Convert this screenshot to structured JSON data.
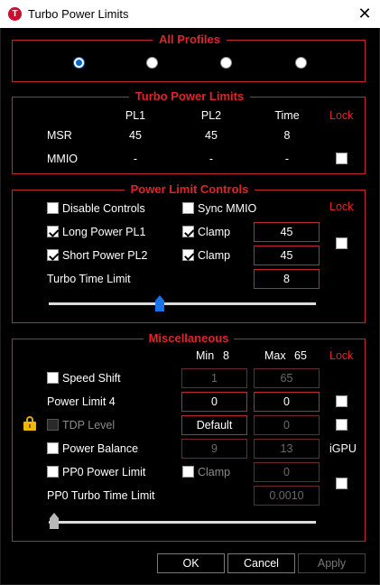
{
  "window": {
    "title": "Turbo Power Limits",
    "icon_letter": "T",
    "close_glyph": "✕"
  },
  "all_profiles": {
    "title": "All Profiles",
    "selected_index": 0,
    "count": 4
  },
  "turbo_power_limits": {
    "title": "Turbo Power Limits",
    "headers": {
      "pl1": "PL1",
      "pl2": "PL2",
      "time": "Time",
      "lock": "Lock"
    },
    "rows": [
      {
        "label": "MSR",
        "pl1": "45",
        "pl2": "45",
        "time": "8"
      },
      {
        "label": "MMIO",
        "pl1": "-",
        "pl2": "-",
        "time": "-"
      }
    ],
    "mmio_lock_checked": false
  },
  "power_limit_controls": {
    "title": "Power Limit Controls",
    "lock_label": "Lock",
    "disable_controls": {
      "label": "Disable Controls",
      "checked": false
    },
    "sync_mmio": {
      "label": "Sync MMIO",
      "checked": false
    },
    "long_power": {
      "label": "Long Power PL1",
      "checked": true,
      "clamp_label": "Clamp",
      "clamp_checked": true,
      "value": "45"
    },
    "short_power": {
      "label": "Short Power PL2",
      "checked": true,
      "clamp_label": "Clamp",
      "clamp_checked": true,
      "value": "45"
    },
    "turbo_time": {
      "label": "Turbo Time Limit",
      "value": "8"
    },
    "lock_checked": false,
    "slider_fraction": 0.41
  },
  "miscellaneous": {
    "title": "Miscellaneous",
    "min_label": "Min",
    "min_value": "8",
    "max_label": "Max",
    "max_value": "65",
    "lock_label": "Lock",
    "speed_shift": {
      "label": "Speed Shift",
      "checked": false,
      "min": "1",
      "max": "65"
    },
    "power_limit_4": {
      "label": "Power Limit 4",
      "min": "0",
      "max": "0",
      "lock_checked": false
    },
    "tdp_level": {
      "label": "TDP Level",
      "checked": false,
      "min": "Default",
      "max": "0",
      "lock_checked": false
    },
    "power_balance": {
      "label": "Power Balance",
      "checked": false,
      "min": "9",
      "max": "13",
      "suffix": "iGPU"
    },
    "pp0_power_limit": {
      "label": "PP0 Power Limit",
      "checked": false,
      "clamp_label": "Clamp",
      "clamp_checked": false,
      "value": "0",
      "lock_checked": false
    },
    "pp0_turbo_time": {
      "label": "PP0 Turbo Time Limit",
      "value": "0.0010"
    },
    "slider_fraction": 0.0
  },
  "buttons": {
    "ok": "OK",
    "cancel": "Cancel",
    "apply": "Apply"
  }
}
